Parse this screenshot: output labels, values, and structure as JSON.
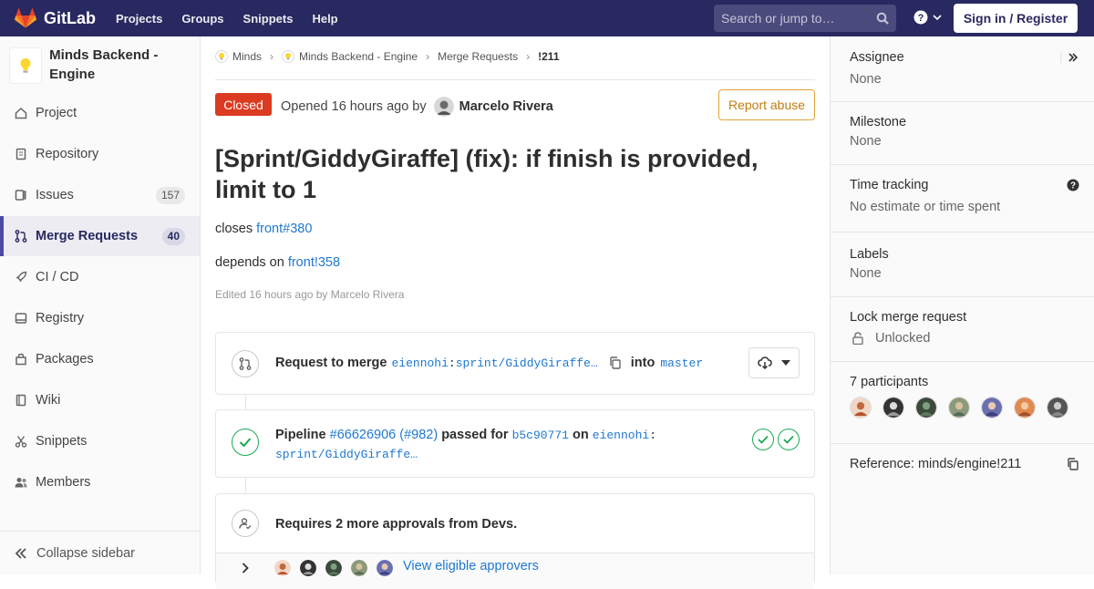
{
  "navbar": {
    "brand": "GitLab",
    "links": [
      "Projects",
      "Groups",
      "Snippets",
      "Help"
    ],
    "search_placeholder": "Search or jump to…",
    "signin_label": "Sign in / Register"
  },
  "sidebar": {
    "project_name": "Minds Backend - Engine",
    "items": [
      {
        "label": "Project",
        "icon": "home-icon"
      },
      {
        "label": "Repository",
        "icon": "doc-icon"
      },
      {
        "label": "Issues",
        "icon": "issues-icon",
        "badge": "157"
      },
      {
        "label": "Merge Requests",
        "icon": "merge-request-icon",
        "badge": "40"
      },
      {
        "label": "CI / CD",
        "icon": "rocket-icon"
      },
      {
        "label": "Registry",
        "icon": "disk-icon"
      },
      {
        "label": "Packages",
        "icon": "package-icon"
      },
      {
        "label": "Wiki",
        "icon": "book-icon"
      },
      {
        "label": "Snippets",
        "icon": "scissors-icon"
      },
      {
        "label": "Members",
        "icon": "users-icon"
      }
    ],
    "collapse_label": "Collapse sidebar"
  },
  "breadcrumb": {
    "items": [
      "Minds",
      "Minds Backend - Engine",
      "Merge Requests"
    ],
    "current": "!211"
  },
  "mr": {
    "status": "Closed",
    "opened_text": "Opened 16 hours ago by",
    "author": "Marcelo Rivera",
    "report_label": "Report abuse",
    "title": "[Sprint/GiddyGiraffe] (fix): if finish is provided, limit to 1",
    "desc_closes_prefix": "closes",
    "desc_closes_link": "front#380",
    "desc_depends_prefix": "depends on",
    "desc_depends_link": "front!358",
    "edited_text": "Edited 16 hours ago by Marcelo Rivera"
  },
  "merge_widget": {
    "request_label": "Request to merge",
    "source_ns": "eiennohi",
    "source_branch": "sprint/GiddyGiraffe…",
    "into_label": "into",
    "target_branch": "master"
  },
  "pipeline": {
    "label": "Pipeline",
    "id_link": "#66626906",
    "iid_link": "(#982)",
    "passed_for": "passed for",
    "commit": "b5c90771",
    "on_label": "on",
    "branch_ns": "eiennohi",
    "branch": "sprint/GiddyGiraffe…"
  },
  "approvals": {
    "text": "Requires 2 more approvals from Devs.",
    "view_link": "View eligible approvers"
  },
  "right_sidebar": {
    "assignee_label": "Assignee",
    "assignee_value": "None",
    "milestone_label": "Milestone",
    "milestone_value": "None",
    "time_label": "Time tracking",
    "time_value": "No estimate or time spent",
    "labels_label": "Labels",
    "labels_value": "None",
    "lock_label": "Lock merge request",
    "lock_value": "Unlocked",
    "participants_label": "7 participants",
    "reference_label": "Reference: minds/engine!211"
  },
  "colors": {
    "navbar": "#292961",
    "closed_badge": "#db3b21",
    "link": "#1f78d1",
    "success": "#1aaa55",
    "report_border": "#e2a337"
  }
}
